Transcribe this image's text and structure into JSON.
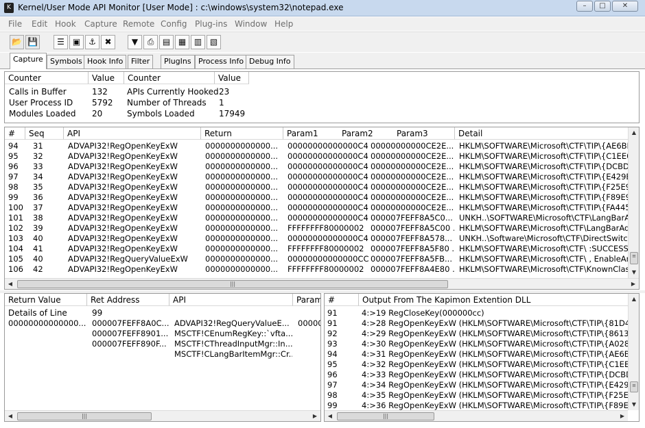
{
  "window": {
    "title": "Kernel/User Mode API Monitor [User Mode]  : c:\\windows\\system32\\notepad.exe",
    "icon_glyph": "K",
    "min_glyph": "–",
    "max_glyph": "□",
    "close_glyph": "✕"
  },
  "menu": [
    "File",
    "Edit",
    "Hook",
    "Capture",
    "Remote",
    "Config",
    "Plug-ins",
    "Window",
    "Help"
  ],
  "toolbar": {
    "open_glyph": "📂",
    "save_glyph": "💾",
    "b3_glyph": "☰",
    "b4_glyph": "▣",
    "b5_glyph": "⚓",
    "b6_glyph": "✖",
    "b7_glyph": "▼",
    "b8_glyph": "⎙",
    "b9_glyph": "▤",
    "b10_glyph": "▦",
    "b11_glyph": "▥",
    "b12_glyph": "▧"
  },
  "tabs": [
    "Capture",
    "Symbols",
    "Hook Info",
    "Filter",
    "PlugIns",
    "Process Info",
    "Debug Info"
  ],
  "counters": {
    "headers": [
      "Counter",
      "Value",
      "Counter",
      "Value"
    ],
    "rows": [
      {
        "c1": "Calls in Buffer",
        "v1": "132",
        "c2": "APIs Currently Hooked",
        "v2": "23"
      },
      {
        "c1": "User Process ID",
        "v1": "5792",
        "c2": "Number of Threads",
        "v2": "1"
      },
      {
        "c1": "Modules Loaded",
        "v1": "20",
        "c2": "Symbols Loaded",
        "v2": "17949"
      }
    ]
  },
  "log": {
    "headers": [
      "#",
      "Seq",
      "API",
      "Return",
      "Param1",
      "Param2",
      "Param3",
      "Detail"
    ],
    "rows": [
      {
        "num": "94",
        "seq": "31",
        "api": "ADVAPI32!RegOpenKeyExW",
        "ret": "0000000000000...",
        "p1": "00000000000000C4",
        "p2": "00000000000CE2E...",
        "detail": "HKLM\\SOFTWARE\\Microsoft\\CTF\\TIP\\{AE6BE"
      },
      {
        "num": "95",
        "seq": "32",
        "api": "ADVAPI32!RegOpenKeyExW",
        "ret": "0000000000000...",
        "p1": "00000000000000C4",
        "p2": "00000000000CE2E...",
        "detail": "HKLM\\SOFTWARE\\Microsoft\\CTF\\TIP\\{C1EE0"
      },
      {
        "num": "96",
        "seq": "33",
        "api": "ADVAPI32!RegOpenKeyExW",
        "ret": "0000000000000...",
        "p1": "00000000000000C4",
        "p2": "00000000000CE2E...",
        "detail": "HKLM\\SOFTWARE\\Microsoft\\CTF\\TIP\\{DCBD8"
      },
      {
        "num": "97",
        "seq": "34",
        "api": "ADVAPI32!RegOpenKeyExW",
        "ret": "0000000000000...",
        "p1": "00000000000000C4",
        "p2": "00000000000CE2E...",
        "detail": "HKLM\\SOFTWARE\\Microsoft\\CTF\\TIP\\{E429B"
      },
      {
        "num": "98",
        "seq": "35",
        "api": "ADVAPI32!RegOpenKeyExW",
        "ret": "0000000000000...",
        "p1": "00000000000000C4",
        "p2": "00000000000CE2E...",
        "detail": "HKLM\\SOFTWARE\\Microsoft\\CTF\\TIP\\{F25E9"
      },
      {
        "num": "99",
        "seq": "36",
        "api": "ADVAPI32!RegOpenKeyExW",
        "ret": "0000000000000...",
        "p1": "00000000000000C4",
        "p2": "00000000000CE2E...",
        "detail": "HKLM\\SOFTWARE\\Microsoft\\CTF\\TIP\\{F89E9"
      },
      {
        "num": "100",
        "seq": "37",
        "api": "ADVAPI32!RegOpenKeyExW",
        "ret": "0000000000000...",
        "p1": "00000000000000C4",
        "p2": "00000000000CE2E...",
        "detail": "HKLM\\SOFTWARE\\Microsoft\\CTF\\TIP\\{FA445"
      },
      {
        "num": "101",
        "seq": "38",
        "api": "ADVAPI32!RegOpenKeyExW",
        "ret": "0000000000000...",
        "p1": "00000000000000C4",
        "p2": "000007FEFF8A5C0...",
        "detail": "UNKH..\\SOFTWARE\\Microsoft\\CTF\\LangBarA"
      },
      {
        "num": "102",
        "seq": "39",
        "api": "ADVAPI32!RegOpenKeyExW",
        "ret": "0000000000000...",
        "p1": "FFFFFFFF80000002",
        "p2": "000007FEFF8A5C00 ...",
        "detail": "HKLM\\SOFTWARE\\Microsoft\\CTF\\LangBarAdd"
      },
      {
        "num": "103",
        "seq": "40",
        "api": "ADVAPI32!RegOpenKeyExW",
        "ret": "0000000000000...",
        "p1": "00000000000000C4",
        "p2": "000007FEFF8A578...",
        "detail": "UNKH..\\Software\\Microsoft\\CTF\\DirectSwitch"
      },
      {
        "num": "104",
        "seq": "41",
        "api": "ADVAPI32!RegOpenKeyExW",
        "ret": "0000000000000...",
        "p1": "FFFFFFFF80000002",
        "p2": "000007FEFF8A5F80 ...",
        "detail": "HKLM\\SOFTWARE\\Microsoft\\CTF\\ :SUCCESS"
      },
      {
        "num": "105",
        "seq": "40",
        "api": "ADVAPI32!RegQueryValueExW",
        "ret": "0000000000000...",
        "p1": "00000000000000CC",
        "p2": "000007FEFF8A5FB...",
        "detail": "HKLM\\SOFTWARE\\Microsoft\\CTF\\ , EnableAn"
      },
      {
        "num": "106",
        "seq": "42",
        "api": "ADVAPI32!RegOpenKeyExW",
        "ret": "0000000000000...",
        "p1": "FFFFFFFF80000002",
        "p2": "000007FEFF8A4E80 ...",
        "detail": "HKLM\\SOFTWARE\\Microsoft\\CTF\\KnownClass"
      }
    ]
  },
  "details": {
    "headers": [
      "Return Value",
      "Ret Address",
      "API",
      "Param"
    ],
    "line_label": "Details of Line",
    "line_number": "99",
    "rows": [
      {
        "retval": "00000000000000...",
        "retaddr": "000007FEFF8A0C...",
        "api": "ADVAPI32!RegQueryValueE...",
        "param": "00000"
      },
      {
        "retval": "",
        "retaddr": "000007FEFF8901...",
        "api": "MSCTF!CEnumRegKey::`vfta...",
        "param": ""
      },
      {
        "retval": "",
        "retaddr": "000007FEFF890F...",
        "api": "MSCTF!CThreadInputMgr::In...",
        "param": ""
      },
      {
        "retval": "",
        "retaddr": "",
        "api": "MSCTF!CLangBarItemMgr::Cr...",
        "param": ""
      }
    ]
  },
  "output": {
    "headers": [
      "#",
      "Output From The Kapimon Extention DLL"
    ],
    "rows": [
      {
        "num": "91",
        "text": "4:>19 RegCloseKey(000000cc)"
      },
      {
        "num": "91",
        "text": "4:>28 RegOpenKeyExW (HKLM\\SOFTWARE\\Microsoft\\CTF\\TIP\\{81D4E"
      },
      {
        "num": "92",
        "text": "4:>29 RegOpenKeyExW (HKLM\\SOFTWARE\\Microsoft\\CTF\\TIP\\{8613E"
      },
      {
        "num": "93",
        "text": "4:>30 RegOpenKeyExW (HKLM\\SOFTWARE\\Microsoft\\CTF\\TIP\\{A028A"
      },
      {
        "num": "94",
        "text": "4:>31 RegOpenKeyExW (HKLM\\SOFTWARE\\Microsoft\\CTF\\TIP\\{AE6BE"
      },
      {
        "num": "95",
        "text": "4:>32 RegOpenKeyExW (HKLM\\SOFTWARE\\Microsoft\\CTF\\TIP\\{C1EE0"
      },
      {
        "num": "96",
        "text": "4:>33 RegOpenKeyExW (HKLM\\SOFTWARE\\Microsoft\\CTF\\TIP\\{DCBD8"
      },
      {
        "num": "97",
        "text": "4:>34 RegOpenKeyExW (HKLM\\SOFTWARE\\Microsoft\\CTF\\TIP\\{E429B"
      },
      {
        "num": "98",
        "text": "4:>35 RegOpenKeyExW (HKLM\\SOFTWARE\\Microsoft\\CTF\\TIP\\{F25E9"
      },
      {
        "num": "99",
        "text": "4:>36 RegOpenKeyExW (HKLM\\SOFTWARE\\Microsoft\\CTF\\TIP\\{F89E9"
      }
    ]
  },
  "scrollbar": {
    "up": "▲",
    "down": "▼",
    "left": "◀",
    "right": "▶",
    "grip_v": "≡",
    "grip_h": "|||"
  }
}
